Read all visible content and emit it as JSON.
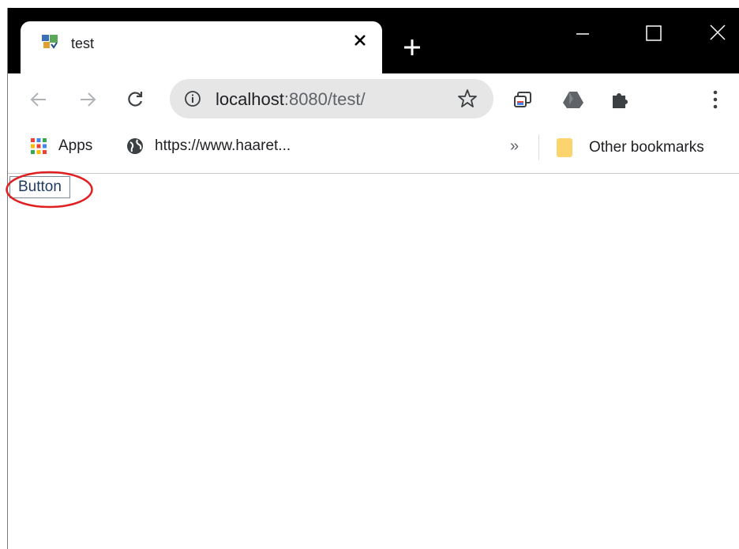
{
  "browser": {
    "tab": {
      "title": "test",
      "favicon": "app-favicon-icon",
      "close_icon": "close-icon"
    },
    "new_tab_icon": "plus-icon",
    "window_controls": [
      "minimize-icon",
      "maximize-icon",
      "close-window-icon"
    ]
  },
  "toolbar": {
    "url_host": "localhost",
    "url_rest": ":8080/test/",
    "icons": [
      "back-arrow-icon",
      "forward-arrow-icon",
      "reload-icon",
      "info-icon",
      "star-icon",
      "cast-icon",
      "google-drive-icon",
      "extensions-icon",
      "kebab-menu-icon"
    ]
  },
  "bookmarks": {
    "apps_label": "Apps",
    "site_label": "https://www.haaret...",
    "overflow": "»",
    "other_label": "Other bookmarks"
  },
  "page": {
    "button_label": "Button"
  },
  "colors": {
    "annotation_ring": "#e02020",
    "titlebar": "#000000",
    "omnibox": "#e6e6e6"
  }
}
